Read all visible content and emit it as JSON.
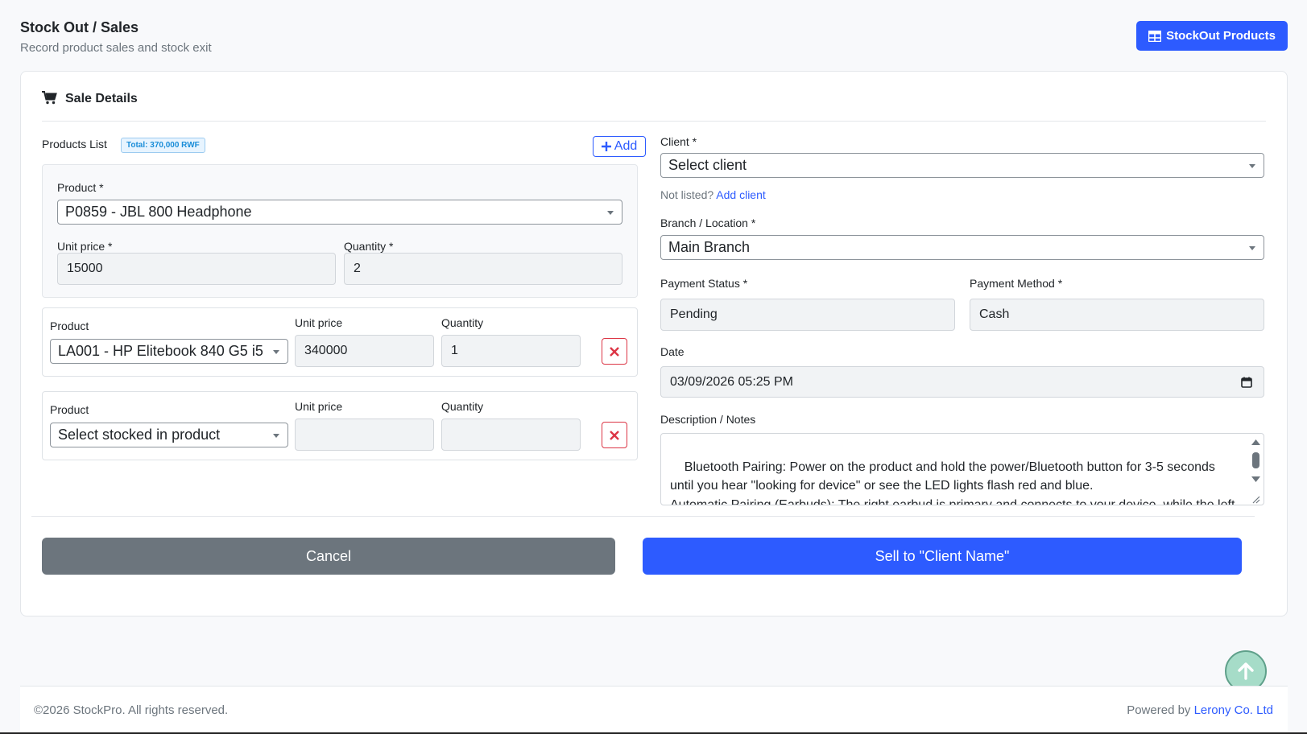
{
  "header": {
    "title": "Stock Out / Sales",
    "subtitle": "Record product sales and stock exit",
    "stockout_button": "StockOut Products"
  },
  "card": {
    "title": "Sale Details"
  },
  "products": {
    "list_label": "Products List",
    "total_badge": "Total: 370,000 RWF",
    "add_button": "Add",
    "first": {
      "product_label": "Product *",
      "product_value": "P0859 - JBL 800 Headphone",
      "unit_price_label": "Unit price *",
      "unit_price_value": "15000",
      "quantity_label": "Quantity *",
      "quantity_value": "2"
    },
    "rows": [
      {
        "product_label": "Product",
        "product_value": "LA001 - HP Elitebook 840 G5 i5",
        "unit_price_label": "Unit price",
        "unit_price_value": "340000",
        "quantity_label": "Quantity",
        "quantity_value": "1"
      },
      {
        "product_label": "Product",
        "product_value": "Select stocked in product",
        "unit_price_label": "Unit price",
        "unit_price_value": "",
        "quantity_label": "Quantity",
        "quantity_value": ""
      }
    ]
  },
  "client": {
    "label": "Client *",
    "value": "Select client",
    "not_listed": "Not listed?",
    "add_link": "Add client"
  },
  "branch": {
    "label": "Branch / Location *",
    "value": "Main Branch"
  },
  "payment_status": {
    "label": "Payment Status *",
    "value": "Pending"
  },
  "payment_method": {
    "label": "Payment Method *",
    "value": "Cash"
  },
  "date": {
    "label": "Date",
    "value": "03/09/2026 05:25  PM"
  },
  "notes": {
    "label": "Description / Notes",
    "value": "Bluetooth Pairing: Power on the product and hold the power/Bluetooth button for 3-5 seconds until you hear \"looking for device\" or see the LED lights flash red and blue.\nAutomatic Pairing (Earbuds): The right earbud is primary and connects to your device, while the left connects to the right. If they do not connect automatically within 15 seconds, check that of"
  },
  "actions": {
    "cancel": "Cancel",
    "sell": "Sell to \"Client Name\""
  },
  "footer": {
    "copyright": "©2026 StockPro. All rights reserved.",
    "powered_by": "Powered by",
    "company": "Lerony Co. Ltd"
  },
  "colors": {
    "primary": "#2d5bff",
    "secondary": "#6c757d",
    "danger": "#dc3545",
    "fab": "#a6dcc8"
  }
}
